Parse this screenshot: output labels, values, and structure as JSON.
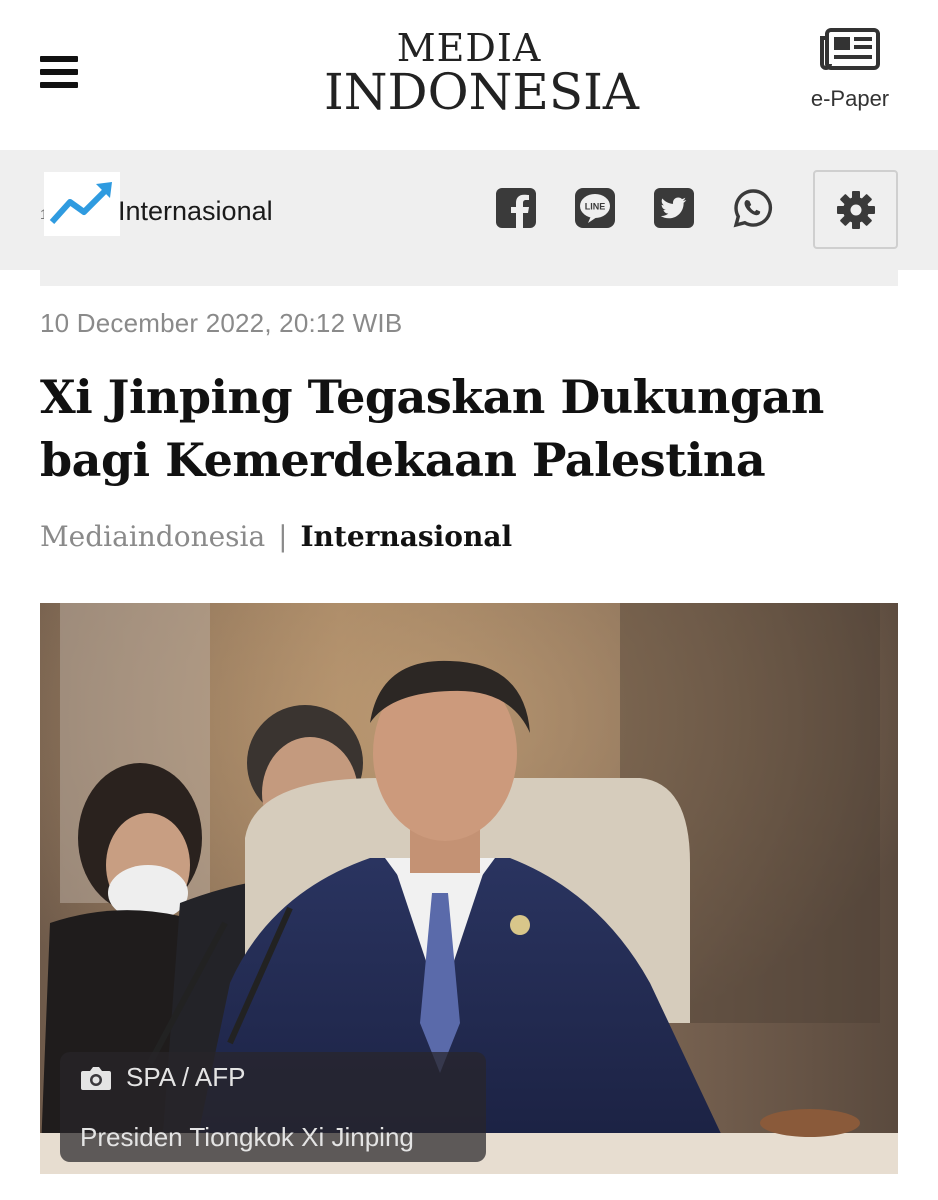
{
  "header": {
    "logo_line1": "MEDIA",
    "logo_line2": "INDONESIA",
    "epaper_label": "e-Paper"
  },
  "toolbar": {
    "breadcrumb_prefix": "1",
    "breadcrumb": "Internasional",
    "share_icons": [
      "facebook-icon",
      "line-icon",
      "twitter-icon",
      "whatsapp-icon"
    ],
    "line_icon_text": "LINE",
    "settings_icon": "gear-icon"
  },
  "article": {
    "date": "10 December 2022, 20:12 WIB",
    "headline_line1": "Xi Jinping Tegaskan Dukungan",
    "headline_line2": "bagi Kemerdekaan Palestina",
    "source": "Mediaindonesia",
    "separator": "|",
    "category": "Internasional"
  },
  "photo": {
    "credit": "SPA / AFP",
    "caption": "Presiden Tiongkok Xi Jinping"
  },
  "colors": {
    "toolbar_bg": "#efefef",
    "icon_dark": "#3a3a3a",
    "trend_blue": "#2f9be0",
    "meta_gray": "#8a8a8a"
  }
}
